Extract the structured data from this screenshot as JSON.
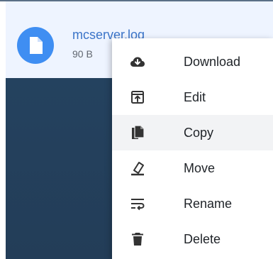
{
  "file": {
    "name": "mcserver.log",
    "size": "90 B",
    "icon": "file-icon"
  },
  "context_menu": {
    "items": [
      {
        "label": "Download",
        "icon": "cloud-download-icon"
      },
      {
        "label": "Edit",
        "icon": "edit-icon"
      },
      {
        "label": "Copy",
        "icon": "copy-icon"
      },
      {
        "label": "Move",
        "icon": "move-icon"
      },
      {
        "label": "Rename",
        "icon": "rename-icon"
      },
      {
        "label": "Delete",
        "icon": "trash-icon"
      }
    ],
    "hovered_label": "Copy"
  },
  "colors": {
    "accent": "#3f8ef2",
    "file_name": "#3b74c8",
    "row_background": "#eef4ff",
    "panel": "#24425f"
  }
}
